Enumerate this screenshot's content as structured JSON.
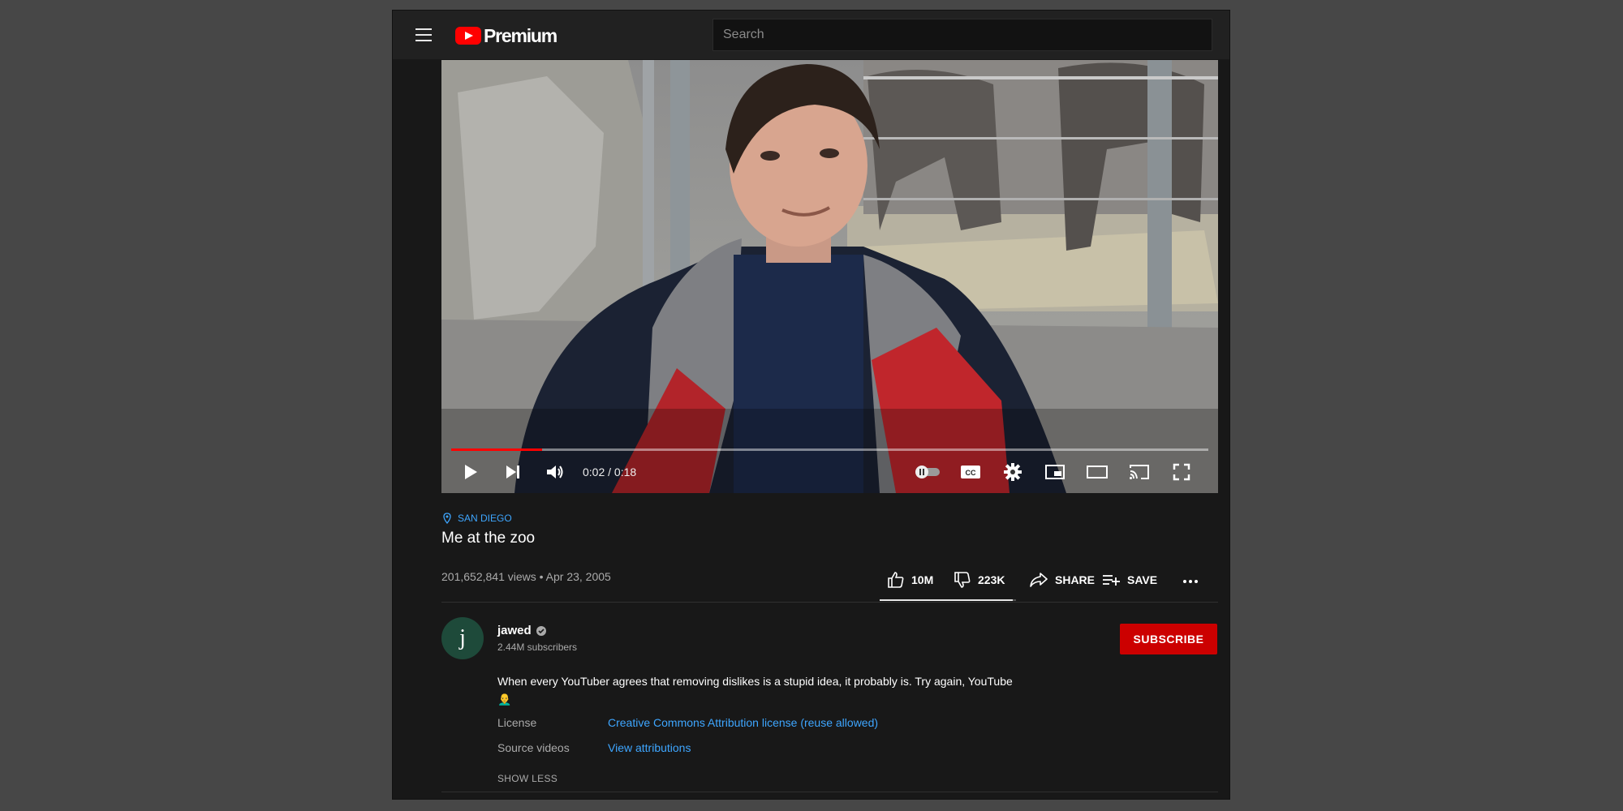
{
  "header": {
    "logo_text": "Premium",
    "search_placeholder": "Search"
  },
  "player": {
    "progress_fraction": 0.12,
    "time": "0:02 / 0:18"
  },
  "video": {
    "location": "SAN DIEGO",
    "title": "Me at the zoo",
    "stats": "201,652,841 views • Apr 23, 2005",
    "likes": "10M",
    "dislikes": "223K",
    "share_label": "SHARE",
    "save_label": "SAVE",
    "like_ratio": 0.978
  },
  "channel": {
    "avatar_letter": "j",
    "name": "jawed",
    "subscribers": "2.44M subscribers",
    "subscribe_label": "SUBSCRIBE"
  },
  "description": {
    "text": "When every YouTuber agrees that removing dislikes is a stupid idea, it probably is. Try again, YouTube 👨‍🦲",
    "license_label": "License",
    "license_value": "Creative Commons Attribution license (reuse allowed)",
    "source_label": "Source videos",
    "source_value": "View attributions",
    "show_less": "SHOW LESS"
  },
  "colors": {
    "brand_red": "#ff0000",
    "link_blue": "#3ea6ff",
    "subscribe_red": "#cc0000"
  }
}
